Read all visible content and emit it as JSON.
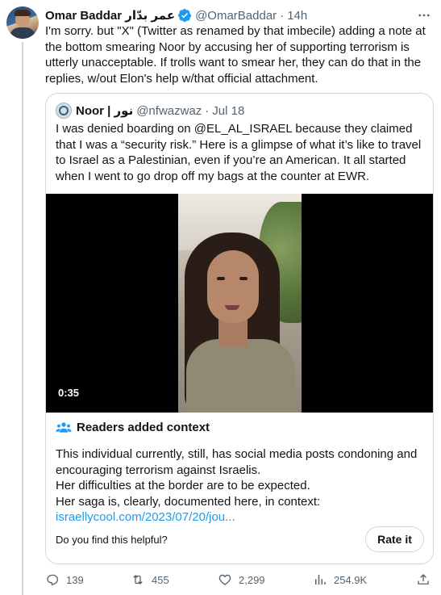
{
  "tweet": {
    "author_name": "Omar Baddar عمر بدّار",
    "handle": "@OmarBaddar",
    "separator": "·",
    "time": "14h",
    "text": "I'm sorry. but \"X\" (Twitter as renamed by that imbecile) adding a note at the bottom smearing Noor by accusing her of supporting terrorism is utterly unacceptable. If trolls want to smear her, they can do that in the replies, w/out Elon's help w/that official attachment."
  },
  "quote": {
    "author_name": "Noor | نور",
    "handle": "@nfwazwaz",
    "separator": "·",
    "time": "Jul 18",
    "text": "I was denied boarding on @EL_AL_ISRAEL because they claimed that I was a “security risk.” Here is a glimpse of what it’s like to travel to Israel as a Palestinian, even if you’re an American. It all started when I went to go drop off my bags at the counter at EWR.",
    "video_duration": "0:35"
  },
  "community_note": {
    "heading": "Readers added context",
    "line1": "This individual currently, still, has social media posts condoning and encouraging terrorism against Israelis.",
    "line2": "Her difficulties at the border are to be expected.",
    "line3": "Her saga is, clearly, documented here, in context:",
    "link": "israellycool.com/2023/07/20/jou...",
    "helpful_prompt": "Do you find this helpful?",
    "rate_label": "Rate it"
  },
  "actions": {
    "replies": "139",
    "reposts": "455",
    "likes": "2,299",
    "views": "254.9K"
  },
  "colors": {
    "text": "#0f1419",
    "secondary": "#536471",
    "accent": "#1d9bf0",
    "border": "#cfd9de"
  },
  "icons": [
    "verified-badge-icon",
    "more-icon",
    "people-icon",
    "reply-icon",
    "repost-icon",
    "like-icon",
    "views-icon",
    "share-icon"
  ]
}
